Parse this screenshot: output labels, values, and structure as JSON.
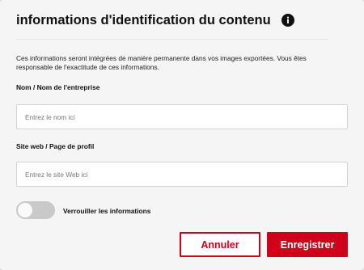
{
  "dialog": {
    "title": "informations d'identification du contenu",
    "info_icon": "info-icon",
    "description": "Ces informations seront intégrées de manière permanente dans vos images exportées. Vous êtes responsable de l'exactitude de ces informations."
  },
  "fields": {
    "name_label": "Nom / Nom de l'entreprise",
    "name_placeholder": "Entrez le nom ici",
    "name_value": "",
    "website_label": "Site web / Page de profil",
    "website_placeholder": "Entrez le site Web ici",
    "website_value": ""
  },
  "lock_toggle": {
    "label": "Verrouiller les informations",
    "checked": false
  },
  "buttons": {
    "cancel_label": "Annuler",
    "save_label": "Enregistrer"
  },
  "colors": {
    "accent": "#d0021b",
    "toggle_off": "#c9c9c9",
    "background": "#f5f5f5"
  }
}
